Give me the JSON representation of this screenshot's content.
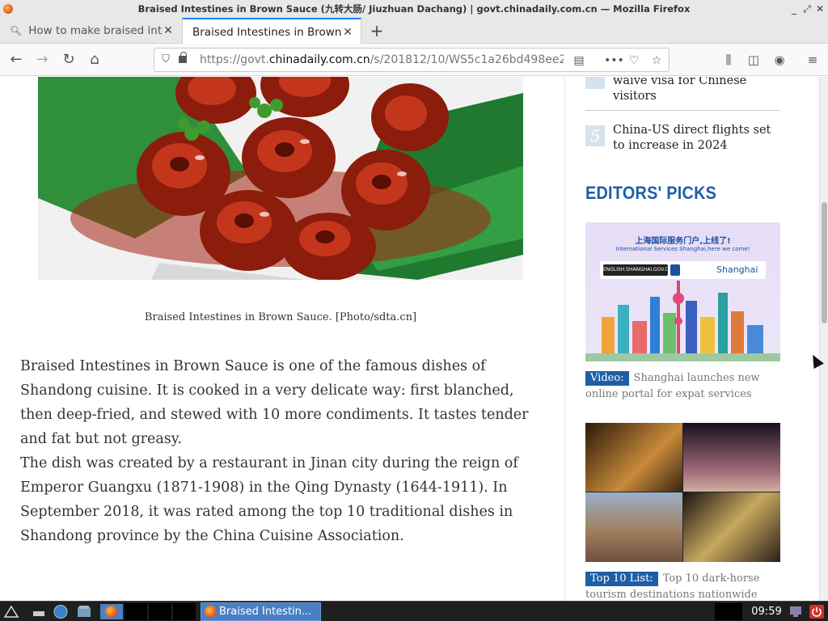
{
  "window": {
    "title": "Braised Intestines in Brown Sauce (九转大肠/ Jiuzhuan Dachang) | govt.chinadaily.com.cn — Mozilla Firefox",
    "buttons": [
      "_",
      "⤢",
      "✕"
    ]
  },
  "tabs": [
    {
      "label": "How to make braised int"
    },
    {
      "label": "Braised Intestines in Brown"
    }
  ],
  "navbar": {
    "url_prefix": "https://govt.",
    "url_domain": "chinadaily.com.cn",
    "url_suffix": "/s/201812/10/WS5c1a26bd498ee2"
  },
  "article": {
    "caption": "Braised Intestines in Brown Sauce. [Photo/sdta.cn]",
    "paragraphs": [
      "Braised Intestines in Brown Sauce is one of the famous dishes of Shandong cuisine. It is cooked in a very delicate way: first blanched, then deep-fried, and stewed with 10 more condiments. It tastes tender and fat but not greasy.",
      "The dish was created by a restaurant in Jinan city during the reign of Emperor Guangxu (1871-1908) in the Qing Dynasty (1644-1911). In September 2018, it was rated among the top 10 traditional dishes in Shandong province by the China Cuisine Association."
    ]
  },
  "sidebar": {
    "ranked": [
      {
        "num": "",
        "text": "waive visa for Chinese visitors"
      },
      {
        "num": "5",
        "text": "China-US direct flights set to increase in 2024"
      }
    ],
    "editors_title": "EDITORS' PICKS",
    "picks": [
      {
        "tag": "Video:",
        "text": "Shanghai launches new online portal for expat services",
        "banner_cn": "上海国际服务门户,上线了!",
        "banner_en": "International Services Shanghai,here we come!",
        "banner_site": "ENGLISH.SHANGHAI.GOV.CN",
        "banner_brand": "Shanghai"
      },
      {
        "tag": "Top 10 List:",
        "text": "Top 10 dark-horse tourism destinations nationwide"
      }
    ]
  },
  "taskbar": {
    "task_label": "Braised Intestin...",
    "clock": "09:59"
  }
}
